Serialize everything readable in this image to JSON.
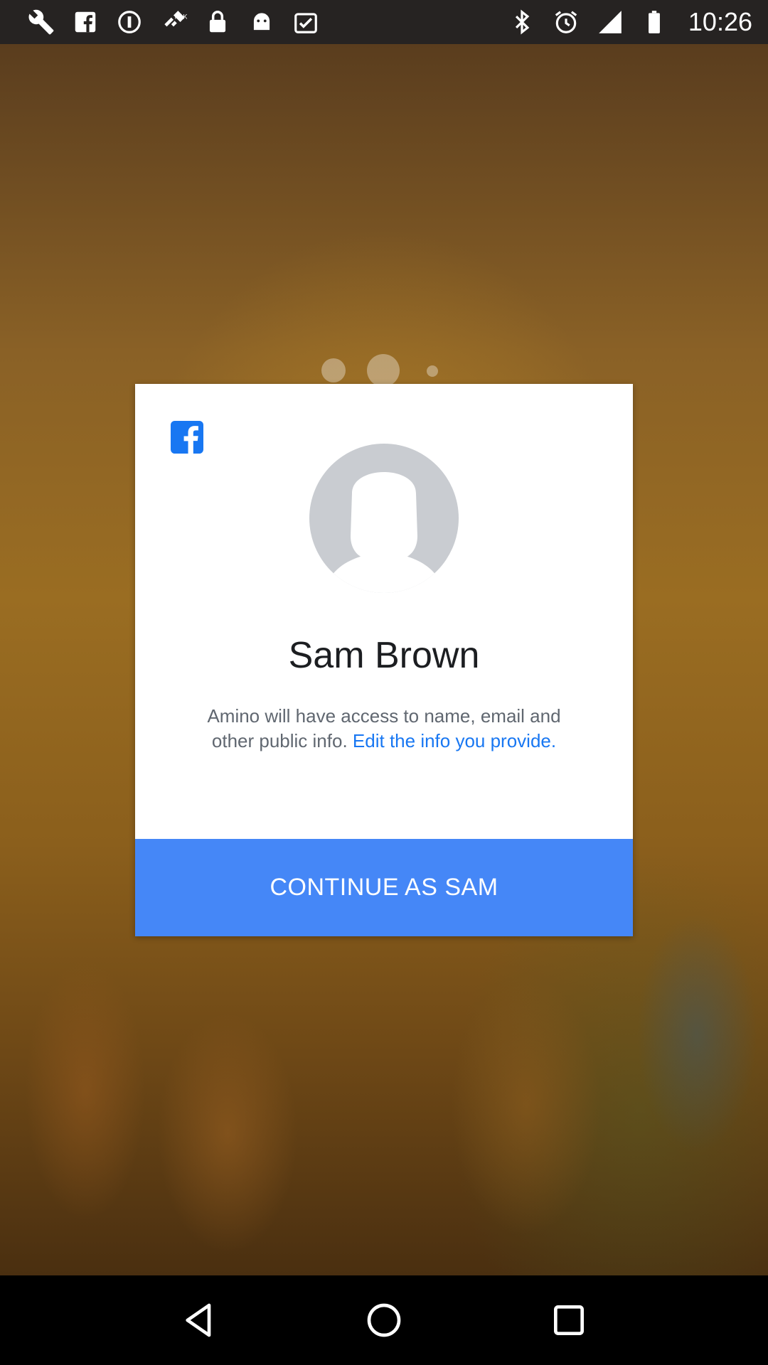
{
  "status_bar": {
    "time": "10:26",
    "left_icons": [
      "wrench-icon",
      "facebook-icon",
      "download-icon",
      "satellite-icon",
      "lock-icon",
      "android-icon",
      "clipboard-check-icon"
    ],
    "right_icons": [
      "bluetooth-icon",
      "alarm-icon",
      "signal-icon",
      "battery-icon"
    ]
  },
  "dialog": {
    "user_name": "Sam Brown",
    "permission_text": "Amino will have access to name, email and other public info.",
    "edit_link": "Edit the info you provide.",
    "continue_button": "CONTINUE AS SAM"
  },
  "colors": {
    "accent": "#4587f7",
    "link": "#1877f2",
    "facebook_blue": "#1877f2"
  },
  "nav_bar": {
    "buttons": [
      "back-icon",
      "home-icon",
      "recents-icon"
    ]
  }
}
